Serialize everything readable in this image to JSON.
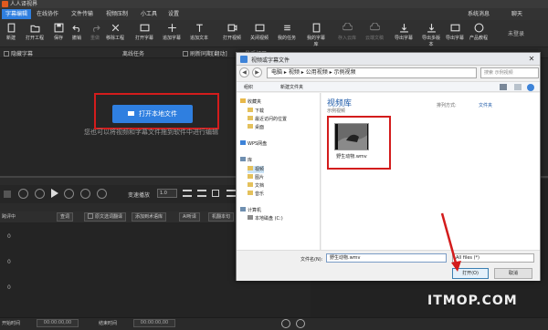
{
  "app": {
    "title": "人人译视界"
  },
  "menu": {
    "items": [
      "字幕编辑",
      "在线协作",
      "文件传输",
      "视频压制",
      "小工具",
      "设置"
    ],
    "right": [
      "系统消息",
      "聊天"
    ]
  },
  "toolbar": {
    "buttons": [
      "新建",
      "打开工程",
      "保存",
      "撤销",
      "重做",
      "移除工程",
      "打开字幕",
      "追加字幕",
      "追加文本",
      "打开视频",
      "关闭视频",
      "我的任务",
      "我的字幕库",
      "存入云库",
      "云端文稿",
      "导出字幕",
      "导出多版本",
      "导出字幕",
      "产品教程"
    ],
    "user": "未登录"
  },
  "subbar": {
    "hide_subtitle": "隐藏字幕",
    "offline_task": "离线任务",
    "refresh": "刷新同期[翻动]",
    "recent": "最近打开"
  },
  "workarea": {
    "open_button": "打开本地文件",
    "hint": "您也可以将视频和字幕文件拖到软件中进行编辑"
  },
  "controls": {
    "speed_label": "变速播放",
    "speed_value": "1.0"
  },
  "optbar": {
    "options": [
      "跨评中",
      "查词",
      "原文选词翻译",
      "添加到术语库",
      "AI听译",
      "机翻本句"
    ]
  },
  "timecol": {
    "rows": [
      "0",
      "0",
      "0"
    ]
  },
  "bottom": {
    "start_label": "开始时间",
    "start_value": "00:00:00,00",
    "end_label": "结束时间",
    "end_value": "00:00:00,00"
  },
  "dialog": {
    "title": "视频或字幕文件",
    "path": [
      "电脑",
      "视频",
      "公用视频",
      "示例视频"
    ],
    "search_placeholder": "搜索 示例视频",
    "tools": {
      "organize": "组织",
      "new_folder": "新建文件夹"
    },
    "nav": [
      {
        "label": "收藏夹",
        "kind": "star"
      },
      {
        "label": "下载",
        "kind": "folder"
      },
      {
        "label": "最近访问的位置",
        "kind": "folder"
      },
      {
        "label": "桌面",
        "kind": "folder"
      },
      {
        "label": "WPS网盘",
        "kind": "cloud"
      },
      {
        "label": "库",
        "kind": "lib"
      },
      {
        "label": "视频",
        "kind": "folder",
        "selected": true
      },
      {
        "label": "图片",
        "kind": "folder"
      },
      {
        "label": "文档",
        "kind": "folder"
      },
      {
        "label": "音乐",
        "kind": "folder"
      },
      {
        "label": "计算机",
        "kind": "pc"
      },
      {
        "label": "本地磁盘 (C:)",
        "kind": "disk"
      }
    ],
    "library_title": "视频库",
    "library_sub": "示例视频",
    "arrange_label": "排列方式:",
    "arrange_value": "文件夹",
    "file_name": "野生动物.wmv",
    "filename_label": "文件名(N):",
    "filename_value": "野生动物.wmv",
    "filetype_value": "All files (*)",
    "open_button": "打开(O)",
    "cancel_button": "取消"
  },
  "watermark": "ITMOP.COM",
  "colors": {
    "accent": "#2f7fe0",
    "highlight": "#d31c1c"
  }
}
